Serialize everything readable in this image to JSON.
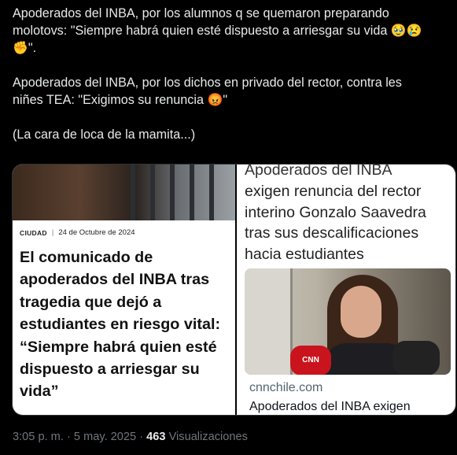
{
  "tweet": {
    "line1": "Apoderados del INBA, por los alumnos q se quemaron preparando",
    "line2": "molotovs: \"Siempre habrá quien esté dispuesto a arriesgar su vida",
    "line2_emojis": [
      "🥹",
      "😢"
    ],
    "line3_emoji": "✊",
    "line3_text": "\".",
    "line4": "Apoderados del INBA, por los dichos en privado del rector, contra les",
    "line5": "niñes TEA: \"Exigimos su renuncia",
    "line5_emoji": "😡",
    "line5_end": "\"",
    "line6": "(La cara de loca de la mamita...)"
  },
  "left_card": {
    "category": "CIUDAD",
    "separator": "|",
    "date": "24 de Octubre de 2024",
    "headline": "El comunicado de apoderados del INBA tras tragedia que dejó a estudiantes en riesgo vital: “Siempre habrá quien esté dispuesto a arriesgar su vida”"
  },
  "right_card": {
    "headline_clipped": "Apoderados del INBA",
    "headline": "exigen renuncia del rector interino Gonzalo Saavedra tras sus descalificaciones hacia estudiantes",
    "mic_label": "CNN CHILE",
    "domain": "cnnchile.com",
    "card_title": "Apoderados del INBA exigen"
  },
  "footer": {
    "time": "3:05 p. m.",
    "dot1": "·",
    "date": "5 may. 2025",
    "dot2": "·",
    "views_count": "463",
    "views_label": "Visualizaciones"
  },
  "colors": {
    "background": "#000000",
    "text": "#e7e9ea",
    "muted": "#71767b"
  }
}
